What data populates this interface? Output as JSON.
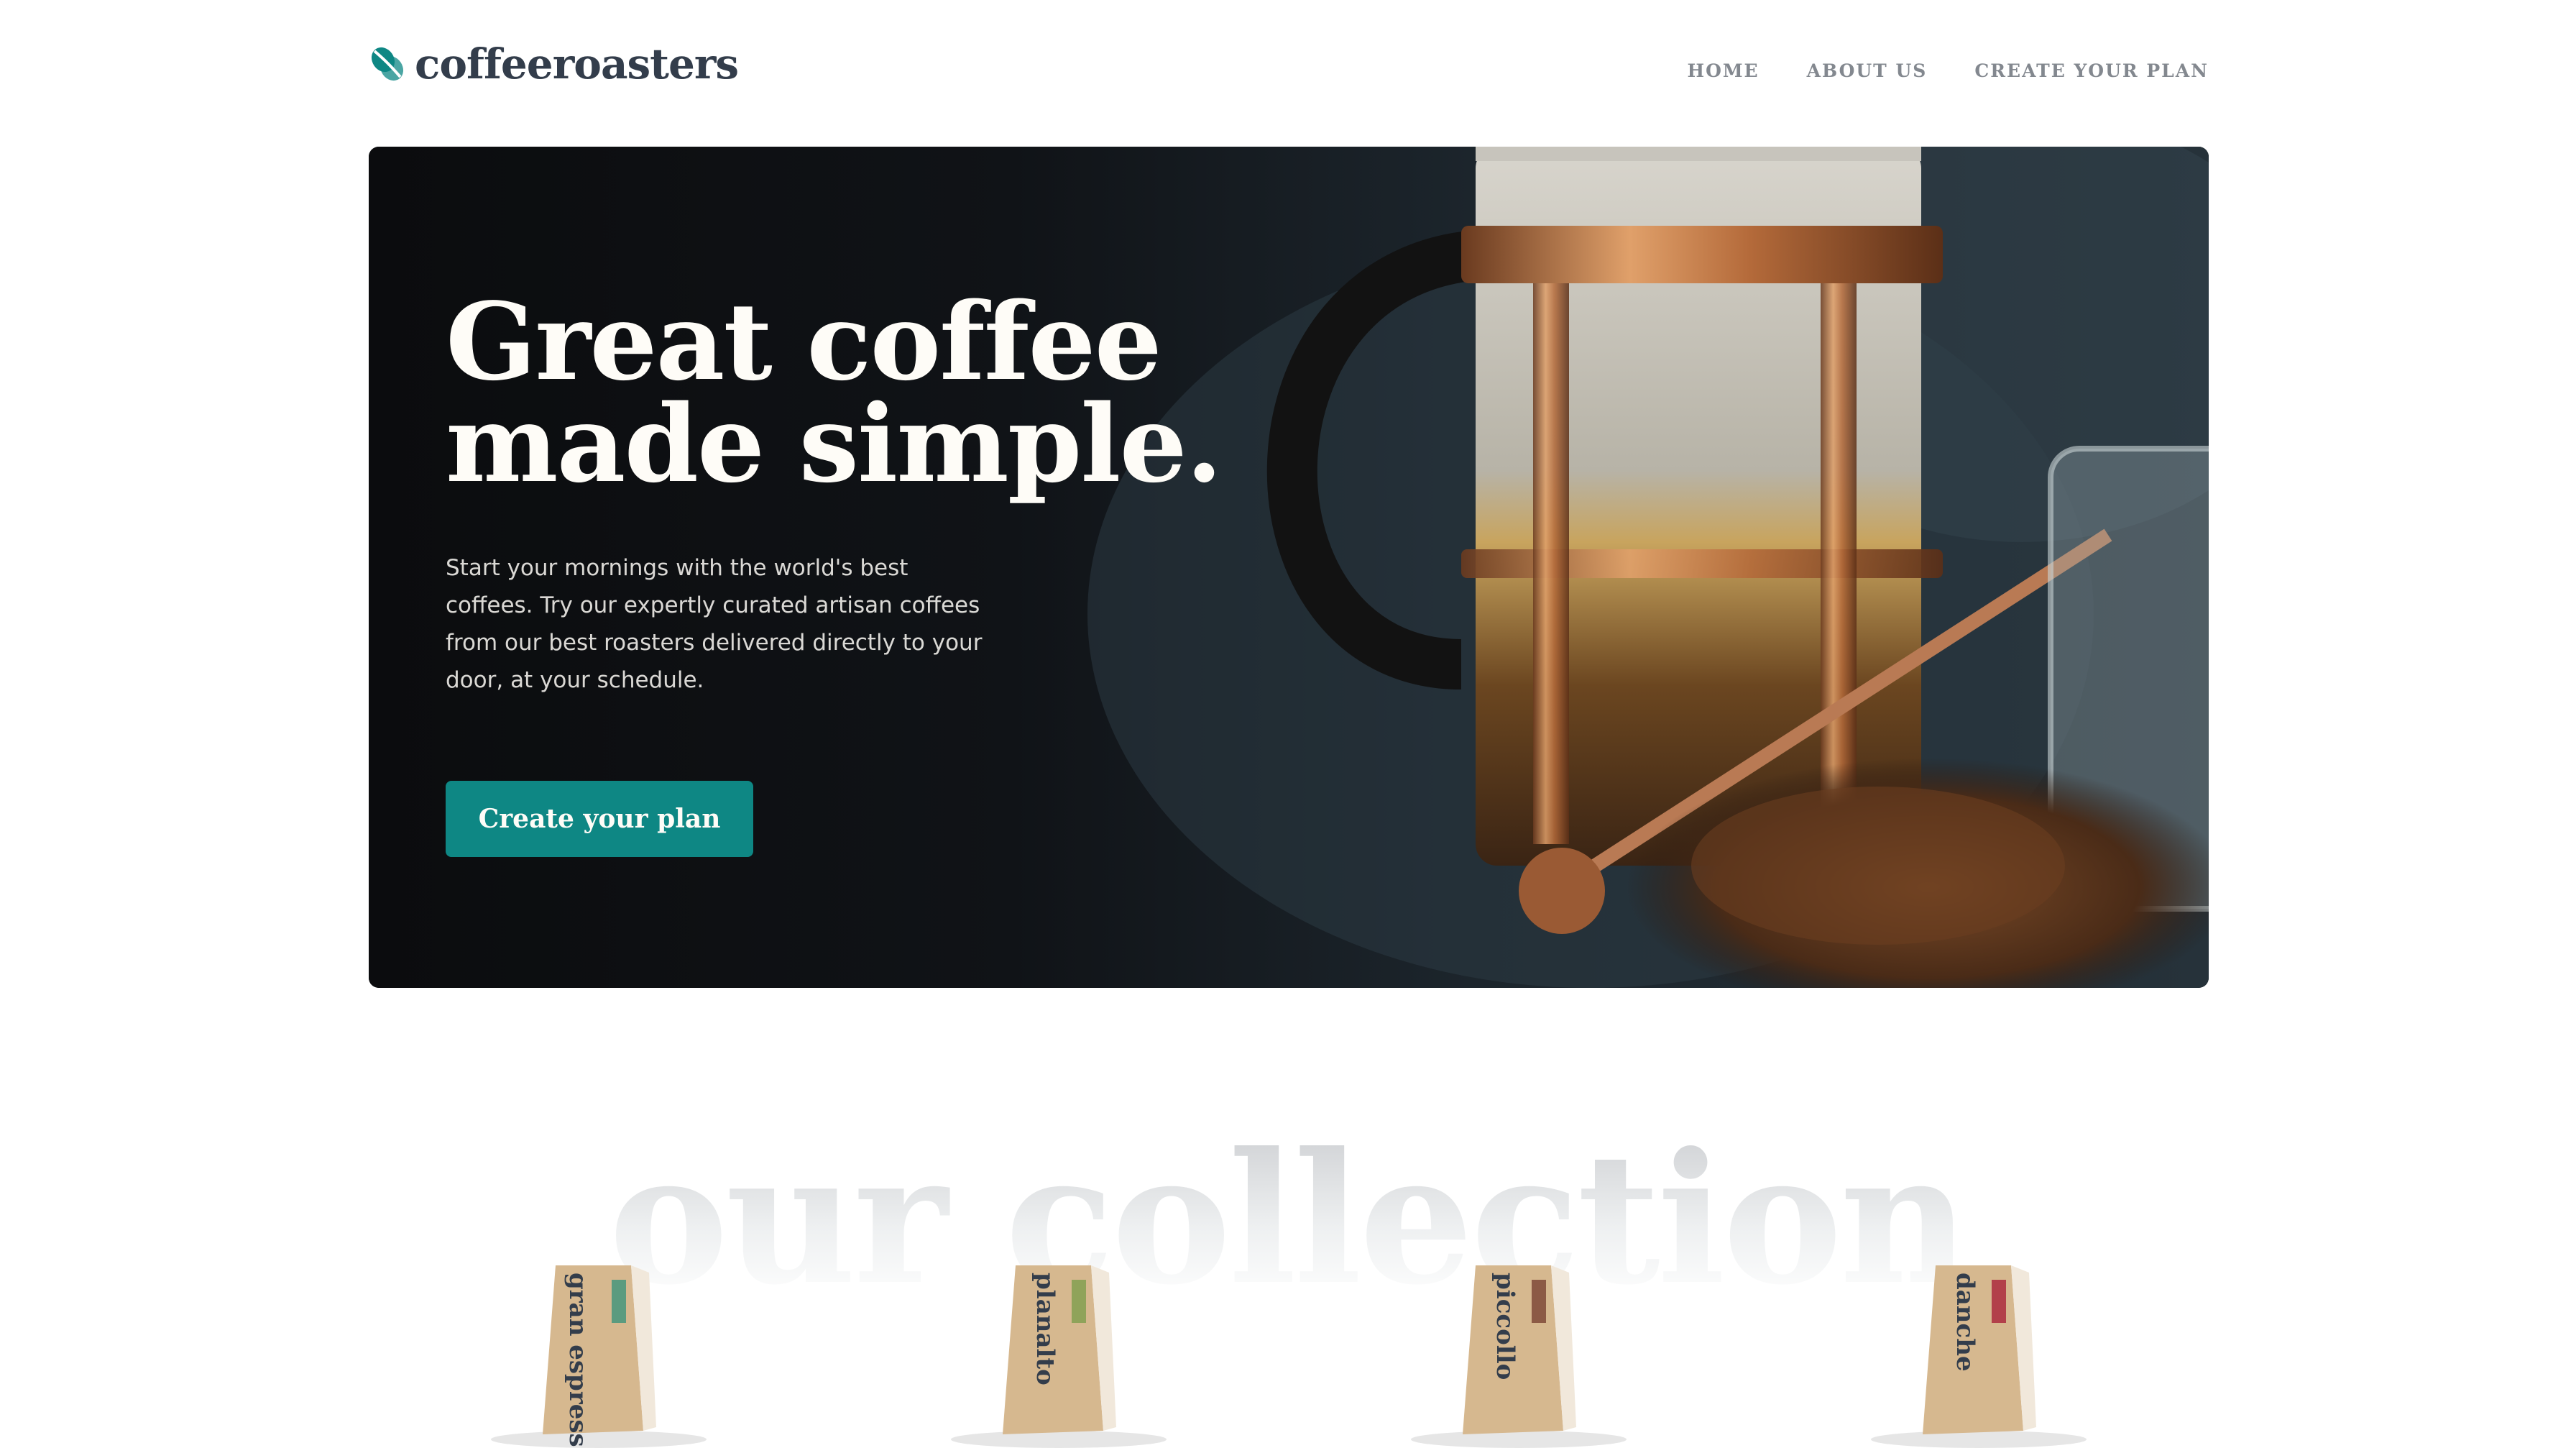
{
  "header": {
    "logo_text": "coffeeroasters",
    "logo_icon": "coffee-bean-icon",
    "nav": [
      {
        "label": "HOME"
      },
      {
        "label": "ABOUT US"
      },
      {
        "label": "CREATE YOUR PLAN"
      }
    ]
  },
  "hero": {
    "title": "Great coffee\nmade simple.",
    "description": "Start your mornings with the world's best coffees. Try our expertly curated artisan coffees from our best roasters delivered directly to your door, at your schedule.",
    "cta_label": "Create your plan"
  },
  "collection": {
    "title": "our collection",
    "products": [
      {
        "name": "gran espresso",
        "accent": "#5b9b7f"
      },
      {
        "name": "planalto",
        "accent": "#8fa35a"
      },
      {
        "name": "piccollo",
        "accent": "#8c5a45"
      },
      {
        "name": "danche",
        "accent": "#b2404a"
      }
    ]
  },
  "colors": {
    "brand_dark": "#333d4b",
    "accent": "#0e8784",
    "nav_text": "#83888f",
    "cream": "#fefcf7"
  }
}
